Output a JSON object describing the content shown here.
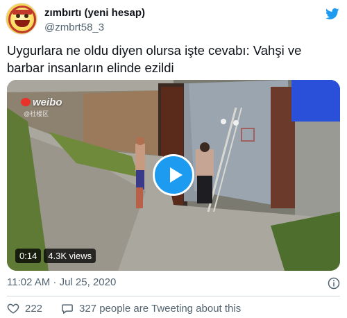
{
  "author": {
    "display_name": "zımbırtı (yeni hesap)",
    "handle": "@zmbrt58_3",
    "avatar_icon": "yellow-cartoon-avatar",
    "platform_icon": "twitter-bird-icon",
    "brand_color": "#1d9bf0"
  },
  "tweet": {
    "text": "Uygurlara ne oldu diyen olursa işte cevabı: Vahşi ve barbar insanların elinde ezildi"
  },
  "media": {
    "watermark": "weibo",
    "watermark_sub": "@社楼区",
    "duration": "0:14",
    "views": "4.3K views",
    "play_icon": "play-icon"
  },
  "meta": {
    "timestamp": "11:02 AM · Jul 25, 2020",
    "info_icon": "info-icon"
  },
  "actions": {
    "likes": "222",
    "replies_text": "327 people are Tweeting about this",
    "like_icon": "heart-icon",
    "reply_icon": "speech-bubble-icon"
  }
}
